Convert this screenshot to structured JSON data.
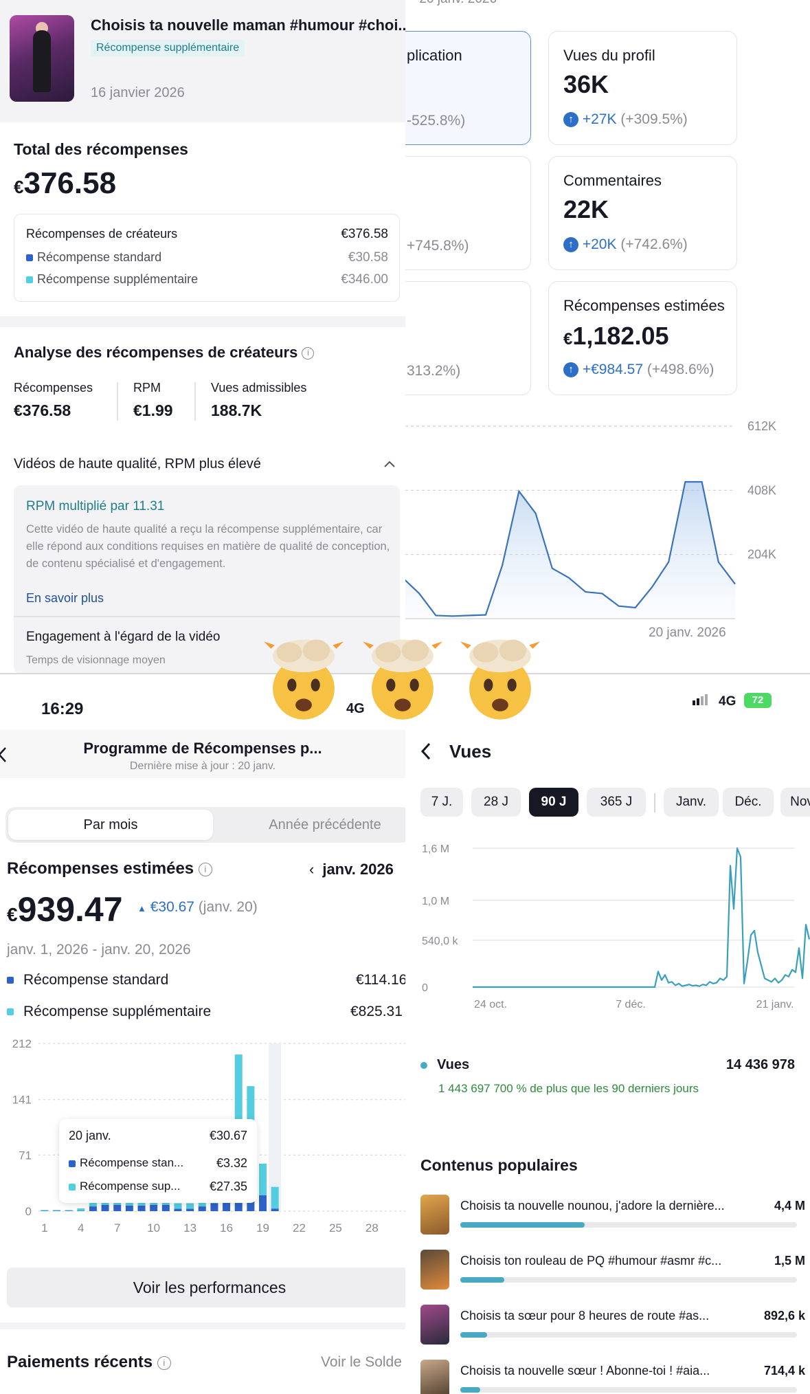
{
  "top_left": {
    "video_title": "Choisis ta nouvelle maman #humour #choi...",
    "video_badge": "Récompense supplémentaire",
    "video_date": "16 janvier 2026",
    "total_label": "Total des récompenses",
    "total_currency": "€",
    "total_value": "376.58",
    "breakdown": {
      "header_label": "Récompenses de créateurs",
      "header_value": "€376.58",
      "rows": [
        {
          "label": "Récompense standard",
          "value": "€30.58",
          "color": "#2d63c8"
        },
        {
          "label": "Récompense supplémentaire",
          "value": "€346.00",
          "color": "#55cde0"
        }
      ]
    },
    "analysis_title": "Analyse des récompenses de créateurs",
    "stats": [
      {
        "label": "Récompenses",
        "value": "€376.58"
      },
      {
        "label": "RPM",
        "value": "€1.99"
      },
      {
        "label": "Vues admissibles",
        "value": "188.7K"
      }
    ],
    "hq_title": "Vidéos de haute qualité, RPM plus élevé",
    "rpm_title": "RPM multiplié par 11.31",
    "rpm_text": "Cette vidéo de haute qualité a reçu la récompense supplémentaire, car elle répond aux conditions requises en matière de qualité de conception, de contenu spécialisé et d'engagement.",
    "learn_more": "En savoir plus",
    "engagement_title": "Engagement à l'égard de la vidéo",
    "engagement_sub": "Temps de visionnage moyen"
  },
  "top_right": {
    "date_header": "~ 20 janv. 2026",
    "kpis": [
      {
        "label": "plication",
        "value": "",
        "delta": "",
        "pct": "-525.8%)",
        "selected": true
      },
      {
        "label": "Vues du profil",
        "value": "36K",
        "delta": "+27K",
        "pct": "(+309.5%)",
        "selected": false
      },
      {
        "label": "",
        "value": "",
        "delta": "",
        "pct": "+745.8%)",
        "selected": false
      },
      {
        "label": "Commentaires",
        "value": "22K",
        "delta": "+20K",
        "pct": "(+742.6%)",
        "selected": false
      },
      {
        "label": "",
        "value": "",
        "delta": "",
        "pct": "313.2%)",
        "selected": false
      },
      {
        "label": "Récompenses estimées",
        "value": "1,182.05",
        "currency": "€",
        "delta": "+€984.57",
        "pct": "(+498.6%)",
        "selected": false
      }
    ],
    "chart_data": {
      "type": "area",
      "y_ticks": [
        "612K",
        "408K",
        "204K"
      ],
      "x_label": "20 janv. 2026",
      "values": [
        130,
        80,
        10,
        8,
        10,
        12,
        170,
        405,
        335,
        160,
        130,
        85,
        80,
        40,
        35,
        100,
        180,
        435,
        435,
        180,
        110
      ],
      "ylim": [
        0,
        612
      ]
    }
  },
  "bottom_left": {
    "status_time": "16:29",
    "status_net": "4G",
    "nav_title": "Programme de Récompenses p...",
    "nav_sub": "Dernière mise à jour : 20 janv.",
    "tabs": [
      "Par mois",
      "Année précédente"
    ],
    "est_label": "Récompenses estimées",
    "month": "janv. 2026",
    "amount_currency": "€",
    "amount": "939.47",
    "delta_value": "€30.67",
    "delta_date": "(janv. 20)",
    "date_range": "janv. 1, 2026 - janv. 20, 2026",
    "legend": [
      {
        "label": "Récompense standard",
        "value": "€114.16",
        "color": "#2d63c8"
      },
      {
        "label": "Récompense supplémentaire",
        "value": "€825.31",
        "color": "#55cde0"
      }
    ],
    "chart_data": {
      "type": "bar",
      "stacked": true,
      "y_ticks": [
        "212",
        "141",
        "71",
        "0"
      ],
      "x_ticks": [
        "1",
        "4",
        "7",
        "10",
        "13",
        "16",
        "19",
        "22",
        "25",
        "28"
      ],
      "ylim": [
        0,
        212
      ],
      "categories": [
        "1",
        "2",
        "3",
        "4",
        "5",
        "6",
        "7",
        "8",
        "9",
        "10",
        "11",
        "12",
        "13",
        "14",
        "15",
        "16",
        "17",
        "18",
        "19",
        "20"
      ],
      "series": [
        {
          "name": "Récompense standard",
          "color": "#2d63c8",
          "values": [
            0.5,
            0.5,
            0.5,
            0.5,
            6,
            8,
            8,
            7,
            7,
            8,
            8,
            3,
            3,
            6,
            10,
            16,
            18,
            18,
            20,
            3.3
          ]
        },
        {
          "name": "Récompense supplémentaire",
          "color": "#55cde0",
          "values": [
            1,
            1,
            1,
            3,
            18,
            18,
            19,
            17,
            19,
            18,
            18,
            7,
            7,
            12,
            22,
            22,
            180,
            140,
            40,
            27.4
          ]
        }
      ]
    },
    "tooltip": {
      "date": "20 janv.",
      "total": "€30.67",
      "rows": [
        {
          "label": "Récompense stan...",
          "value": "€3.32",
          "color": "#2d63c8"
        },
        {
          "label": "Récompense sup...",
          "value": "€27.35",
          "color": "#55cde0"
        }
      ]
    },
    "perf_button": "Voir les performances",
    "payments_title": "Paiements récents",
    "balance_link": "Voir le Solde"
  },
  "bottom_right": {
    "status_net": "4G",
    "battery": "72",
    "title": "Vues",
    "pills": [
      {
        "label": "7 J.",
        "on": false
      },
      {
        "label": "28 J",
        "on": false
      },
      {
        "label": "90 J",
        "on": true
      },
      {
        "label": "365 J",
        "on": false
      },
      {
        "label": "Janv.",
        "on": false
      },
      {
        "label": "Déc.",
        "on": false
      },
      {
        "label": "Nov",
        "on": false
      }
    ],
    "chart_data": {
      "type": "line",
      "y_ticks": [
        "1,6 M",
        "1,0 M",
        "540,0 k",
        "0"
      ],
      "x_ticks": [
        "24 oct.",
        "7 déc.",
        "21 janv."
      ],
      "ylim": [
        0,
        1600000
      ],
      "values": [
        0,
        0,
        0,
        0,
        0,
        0,
        0,
        0,
        0,
        0,
        0,
        0,
        0,
        0,
        0,
        0,
        0,
        0,
        0,
        0,
        0,
        0,
        0,
        0,
        0,
        0,
        0,
        0,
        0,
        0,
        0,
        0,
        0,
        0,
        0,
        0,
        0,
        0,
        0,
        0,
        0,
        0,
        0,
        0,
        0,
        0,
        0,
        0,
        0,
        0,
        0,
        0,
        0,
        0,
        180000,
        80000,
        140000,
        50000,
        60000,
        20000,
        40000,
        10000,
        20000,
        30000,
        15000,
        20000,
        10000,
        30000,
        20000,
        60000,
        40000,
        50000,
        100000,
        80000,
        120000,
        1400000,
        900000,
        1600000,
        1500000,
        40000,
        300000,
        600000,
        650000,
        400000,
        250000,
        100000,
        80000,
        60000,
        100000,
        50000,
        80000,
        140000,
        120000,
        200000,
        170000,
        450000,
        100000,
        720000,
        550000
      ]
    },
    "views_label": "Vues",
    "views_value": "14 436 978",
    "views_note": "1 443 697 700 % de plus que les 90 derniers jours",
    "popular_title": "Contenus populaires",
    "popular": [
      {
        "title": "Choisis ta nouvelle nounou, j'adore la dernière...",
        "value": "4,4 M",
        "fill": 0.37
      },
      {
        "title": "Choisis ton rouleau de PQ #humour #asmr #c...",
        "value": "1,5 M",
        "fill": 0.13
      },
      {
        "title": "Choisis ta sœur pour 8 heures de route #as...",
        "value": "892,6 k",
        "fill": 0.08
      },
      {
        "title": "Choisis ta nouvelle sœur ! Abonne-toi ! #aia...",
        "value": "714,4 k",
        "fill": 0.06
      }
    ]
  }
}
